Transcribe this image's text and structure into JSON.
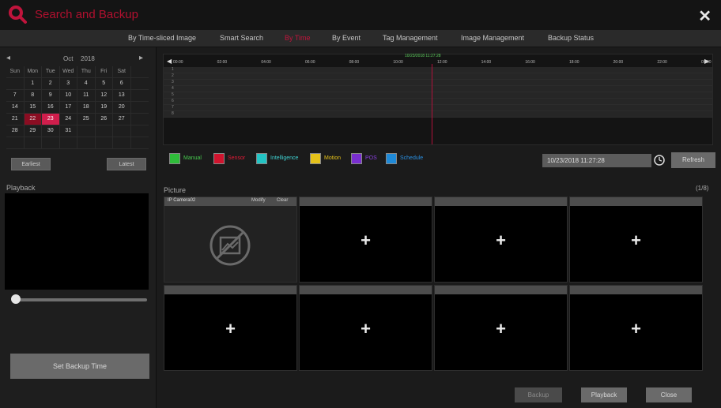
{
  "window": {
    "title": "Search and Backup",
    "icon": "search-icon",
    "close_icon": "close-icon"
  },
  "nav": {
    "tabs": [
      {
        "label": "By Time-sliced Image",
        "active": false
      },
      {
        "label": "Smart Search",
        "active": false
      },
      {
        "label": "By Time",
        "active": true
      },
      {
        "label": "By Event",
        "active": false
      },
      {
        "label": "Tag Management",
        "active": false
      },
      {
        "label": "Image Management",
        "active": false
      },
      {
        "label": "Backup Status",
        "active": false
      }
    ]
  },
  "calendar": {
    "month": "Oct",
    "year": "2018",
    "weekdays": [
      "Sun",
      "Mon",
      "Tue",
      "Wed",
      "Thu",
      "Fri",
      "Sat"
    ],
    "weeks": [
      [
        "",
        "1",
        "2",
        "3",
        "4",
        "5",
        "6"
      ],
      [
        "7",
        "8",
        "9",
        "10",
        "11",
        "12",
        "13"
      ],
      [
        "14",
        "15",
        "16",
        "17",
        "18",
        "19",
        "20"
      ],
      [
        "21",
        "22",
        "23",
        "24",
        "25",
        "26",
        "27"
      ],
      [
        "28",
        "29",
        "30",
        "31",
        "",
        "",
        ""
      ],
      [
        "",
        "",
        "",
        "",
        "",
        "",
        ""
      ]
    ],
    "recorded_days": [
      "22"
    ],
    "selected_day": "23",
    "earliest_label": "Earliest",
    "latest_label": "Latest"
  },
  "playback": {
    "label": "Playback",
    "position": 0.0,
    "set_backup_time_label": "Set Backup Time"
  },
  "timeline": {
    "marks": [
      "00:00",
      "02:00",
      "04:00",
      "06:00",
      "08:00",
      "10:00",
      "12:00",
      "14:00",
      "16:00",
      "18:00",
      "20:00",
      "22:00",
      "00:00"
    ],
    "cursor_time": "10/23/2018 11:27:28",
    "cursor_fraction": 0.477,
    "channels": [
      "1",
      "2",
      "3",
      "4",
      "5",
      "6",
      "7",
      "8"
    ]
  },
  "legend": {
    "items": [
      {
        "label": "Manual",
        "color": "#2fbd3a",
        "text_color": "#46c94e"
      },
      {
        "label": "Sensor",
        "color": "#d0142e",
        "text_color": "#e01a36"
      },
      {
        "label": "Intelligence",
        "color": "#23c4c4",
        "text_color": "#3fd0d0"
      },
      {
        "label": "Motion",
        "color": "#e6c21a",
        "text_color": "#e6c21a"
      },
      {
        "label": "POS",
        "color": "#7a2fd0",
        "text_color": "#8a3fe0"
      },
      {
        "label": "Schedule",
        "color": "#1f8ad8",
        "text_color": "#2a8fe0"
      }
    ],
    "datetime": "10/23/2018 11:27:28",
    "refresh_label": "Refresh"
  },
  "picture": {
    "label": "Picture",
    "count": "(1/8)",
    "tiles": [
      {
        "name": "IP Camera02",
        "modify": "Modify",
        "clear": "Clear",
        "filled": true
      },
      {
        "name": "",
        "filled": false
      },
      {
        "name": "",
        "filled": false
      },
      {
        "name": "",
        "filled": false
      },
      {
        "name": "",
        "filled": false
      },
      {
        "name": "",
        "filled": false
      },
      {
        "name": "",
        "filled": false
      },
      {
        "name": "",
        "filled": false
      }
    ],
    "plus": "+"
  },
  "footer": {
    "backup_label": "Backup",
    "playback_label": "Playback",
    "close_label": "Close"
  }
}
